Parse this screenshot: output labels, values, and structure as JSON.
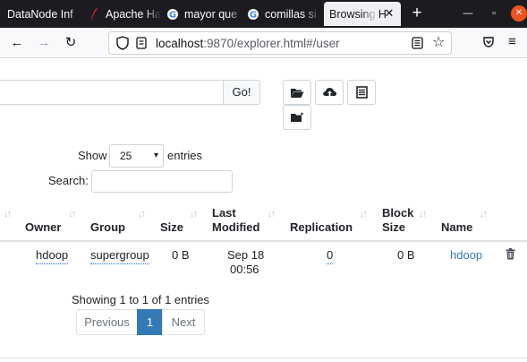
{
  "browser": {
    "tabs": [
      {
        "label": "DataNode Inf",
        "icon": "globe-icon"
      },
      {
        "label": "Apache Ha",
        "icon": "apache-feather-icon"
      },
      {
        "label": "mayor que",
        "icon": "google-icon"
      },
      {
        "label": "comillas si",
        "icon": "google-icon"
      },
      {
        "label": "Browsing H",
        "icon": "",
        "active": true
      }
    ],
    "url_host": "localhost",
    "url_rest": ":9870/explorer.html#/user",
    "colors": {
      "tabbar": "#1c1b22",
      "close_button": "#e95420"
    }
  },
  "explorer": {
    "go_label": "Go!",
    "path_value": "",
    "toolbar_icons": [
      "folder-open-icon",
      "upload-cloud-icon",
      "list-icon",
      "create-folder-icon"
    ]
  },
  "table_controls": {
    "show_label": "Show",
    "entries_label": "entries",
    "page_size": "25",
    "search_label": "Search:",
    "search_value": ""
  },
  "table": {
    "columns": [
      "Owner",
      "Group",
      "Size",
      "Last Modified",
      "Replication",
      "Block Size",
      "Name"
    ],
    "rows": [
      {
        "owner": "hdoop",
        "group": "supergroup",
        "size": "0 B",
        "modified_date": "Sep 18",
        "modified_time": "00:56",
        "replication": "0",
        "block_size": "0 B",
        "name": "hdoop"
      }
    ],
    "colors": {
      "link": "#337ab7"
    }
  },
  "pagination": {
    "info": "Showing 1 to 1 of 1 entries",
    "previous": "Previous",
    "current": "1",
    "next": "Next"
  }
}
